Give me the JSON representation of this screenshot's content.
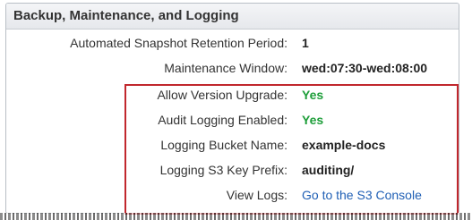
{
  "panel": {
    "title": "Backup, Maintenance, and Logging",
    "rows": [
      {
        "label": "Automated Snapshot Retention Period:",
        "value": "1"
      },
      {
        "label": "Maintenance Window:",
        "value": "wed:07:30-wed:08:00"
      },
      {
        "label": "Allow Version Upgrade:",
        "value": "Yes"
      },
      {
        "label": "Audit Logging Enabled:",
        "value": "Yes"
      },
      {
        "label": "Logging Bucket Name:",
        "value": "example-docs"
      },
      {
        "label": "Logging S3 Key Prefix:",
        "value": "auditing/"
      },
      {
        "label": "View Logs:",
        "value": "Go to the S3 Console"
      }
    ]
  },
  "colors": {
    "highlight": "#c1272d",
    "yes": "#1e9e3a",
    "link": "#1f5fb5"
  }
}
